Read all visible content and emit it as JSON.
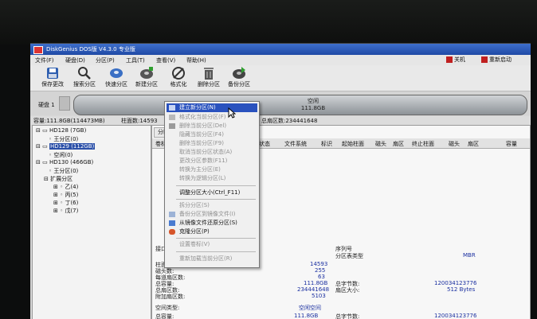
{
  "window": {
    "title": "DiskGenius DOS版 V4.3.0 专业版"
  },
  "menu": {
    "items": [
      "文件(F)",
      "硬盘(D)",
      "分区(P)",
      "工具(T)",
      "查看(V)",
      "帮助(H)"
    ],
    "shutdown": "关机",
    "reboot": "重新启动"
  },
  "toolbar": {
    "buttons": [
      "保存更改",
      "搜索分区",
      "快速分区",
      "新建分区",
      "格式化",
      "删除分区",
      "备份分区"
    ]
  },
  "disk": {
    "label": "硬盘 1",
    "space_title": "空闲",
    "space_size": "111.8GB"
  },
  "info_bar": {
    "capacity": "容量:111.8GB(114473MB)",
    "cylinders": "柱面数:14593",
    "total_sectors": "总扇区数:234441648"
  },
  "tree": {
    "hd0": "HD128 (7GB)",
    "hd0_p1": "王分区(0)",
    "hd1": "HD129 (112GB)",
    "hd1_p1": "空闲(0)",
    "hd2": "HD130 (466GB)",
    "hd2_p1": "王分区(0)",
    "hd2_ext": "扩展分区",
    "hd2_l1": "乙(4)",
    "hd2_l2": "丙(5)",
    "hd2_l3": "丁(6)",
    "hd2_l4": "戊(7)"
  },
  "main": {
    "tabs": [
      "分区",
      "浏览"
    ],
    "columns": [
      "卷标",
      "状态",
      "文件系统",
      "标识",
      "起始柱面",
      "磁头",
      "扇区",
      "终止柱面",
      "磁头",
      "扇区",
      "容量"
    ],
    "detail": {
      "iface_label": "接口类型:",
      "seq_label": "序列号",
      "table_type_label": "分区表类型",
      "table_type_value": "MBR",
      "cyl_label": "柱面数:",
      "cyl_value": "14593",
      "heads_label": "磁头数:",
      "heads_value": "255",
      "spt_label": "每道扇区数:",
      "spt_value": "63",
      "cap_label": "总容量:",
      "cap_value": "111.8GB",
      "total_bytes_label": "总字节数:",
      "total_bytes_value": "120034123776",
      "sectors_label": "总扇区数:",
      "sectors_value": "234441648",
      "sector_size_label": "扇区大小:",
      "sector_size_value": "512 Bytes",
      "extra_label": "附加扇区数:",
      "extra_value": "5103",
      "free_type_label": "空间类型:",
      "free_type_value": "空闲空间",
      "free_cap_label": "总容量:",
      "free_cap_value": "111.8GB",
      "free_bytes_label": "总字节数:",
      "free_bytes_value": "120034123776",
      "free_sectors_label": "总扇区数:",
      "free_sectors_value": "234441648"
    }
  },
  "context_menu": {
    "items": [
      {
        "label": "建立新分区(N)",
        "state": "highlight"
      },
      {
        "label": "格式化当前分区(F)",
        "state": "disabled"
      },
      {
        "label": "删除当前分区(Del)",
        "state": "disabled"
      },
      {
        "label": "隐藏当前分区(F4)",
        "state": "disabled"
      },
      {
        "label": "删除当前分区(F9)",
        "state": "disabled"
      },
      {
        "label": "取消当前分区状态(A)",
        "state": "disabled"
      },
      {
        "label": "更改分区参数(F11)",
        "state": "disabled"
      },
      {
        "label": "转换为主分区(E)",
        "state": "disabled"
      },
      {
        "label": "转换为逻辑分区(L)",
        "state": "disabled"
      },
      {
        "label": "调整分区大小(Ctrl_F11)",
        "state": "enabled"
      },
      {
        "label": "拆分分区(S)",
        "state": "disabled"
      },
      {
        "label": "备份分区到镜像文件(I)",
        "state": "disabled"
      },
      {
        "label": "从镜像文件还原分区(S)",
        "state": "enabled"
      },
      {
        "label": "克隆分区(P)",
        "state": "enabled"
      },
      {
        "label": "设置卷标(V)",
        "state": "disabled"
      },
      {
        "label": "重新加载当前分区(R)",
        "state": "disabled"
      }
    ]
  },
  "colors": {
    "title_bar": "#2a55b8",
    "selection": "#2a52be",
    "disk_bar": "#9aa0a6",
    "shutdown_icon": "#c02020"
  }
}
